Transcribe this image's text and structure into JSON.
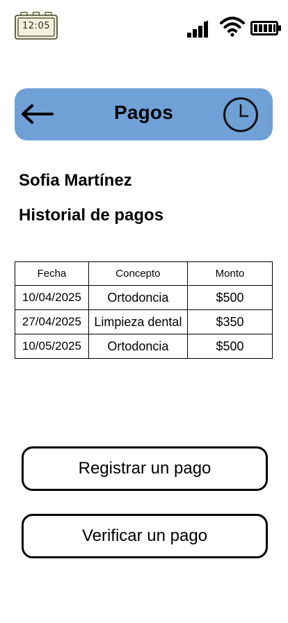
{
  "status_bar": {
    "time": "12:05",
    "icons": [
      "signal-icon",
      "wifi-icon",
      "battery-icon"
    ]
  },
  "header": {
    "title": "Pagos",
    "back_icon": "arrow-left-icon",
    "history_icon": "clock-icon",
    "background_color": "#6fa0d6"
  },
  "patient": {
    "name": "Sofia Martínez"
  },
  "section": {
    "title": "Historial de pagos"
  },
  "payments_table": {
    "headers": {
      "fecha": "Fecha",
      "concepto": "Concepto",
      "monto": "Monto"
    },
    "rows": [
      {
        "fecha": "10/04/2025",
        "concepto": "Ortodoncia",
        "monto": "$500"
      },
      {
        "fecha": "27/04/2025",
        "concepto": "Limpieza dental",
        "monto": "$350"
      },
      {
        "fecha": "10/05/2025",
        "concepto": "Ortodoncia",
        "monto": "$500"
      }
    ]
  },
  "actions": {
    "register_label": "Registrar un pago",
    "verify_label": "Verificar un pago"
  }
}
